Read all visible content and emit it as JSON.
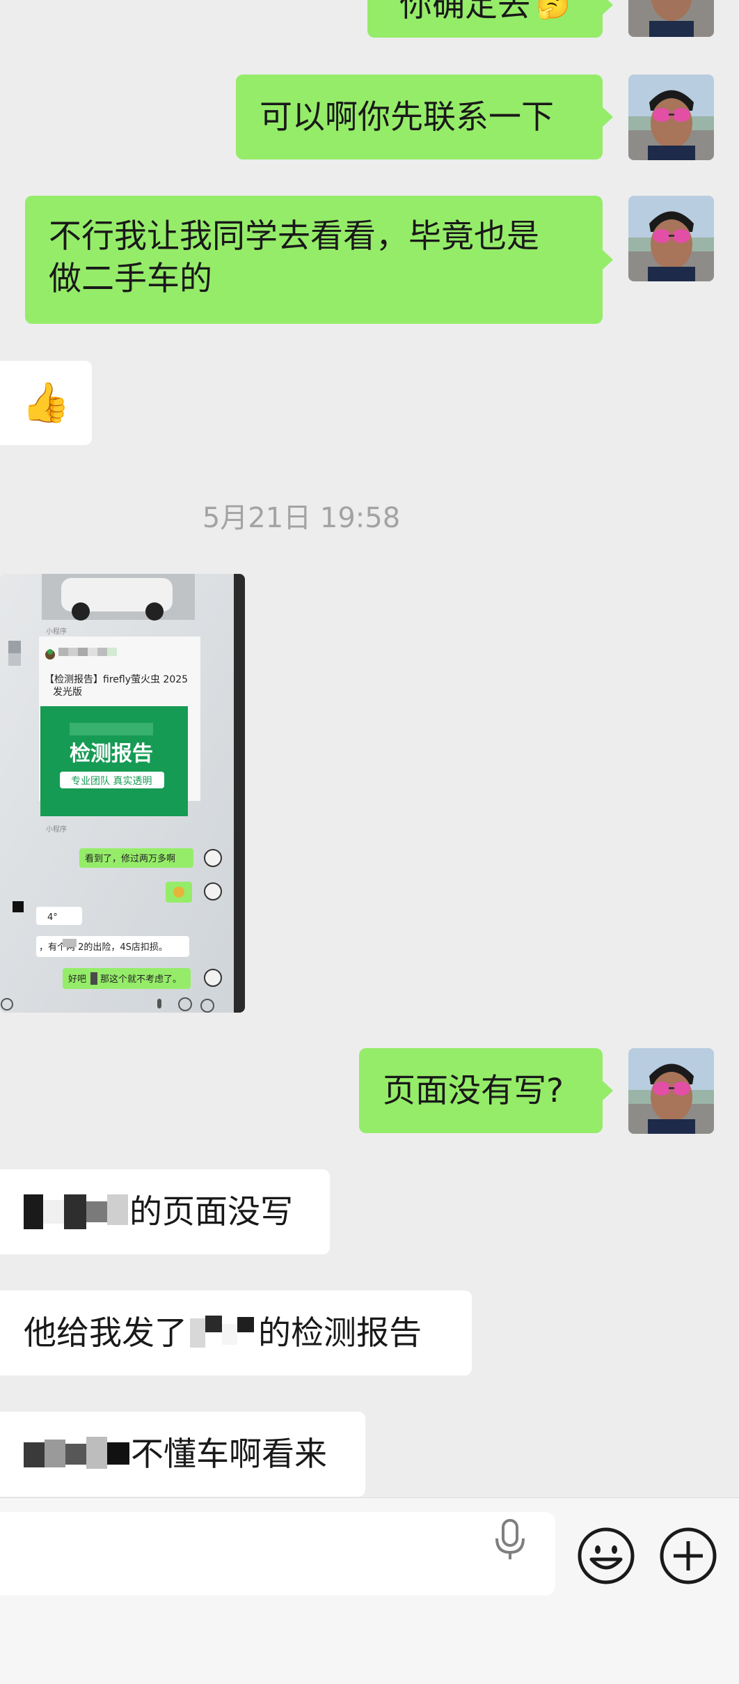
{
  "messages": {
    "m0_partial": "你确定去",
    "m1": "可以啊你先联系一下",
    "m2": "不行我让我同学去看看，毕竟也是做二手车的",
    "m2_line1": "不行我让我同学去看看，毕竟也是",
    "m2_line2": "做二手车的",
    "m3_emoji": "👍",
    "timestamp": "5月21日 19:58",
    "m5": "页面没有写?",
    "m6_text": "的页面没写",
    "m7_prefix": "他给我发了",
    "m7_suffix": "的检测报告",
    "m8_text": "不懂车啊看来"
  },
  "screenshot_image": {
    "mini_program_tag_1": "小程序",
    "card_title_line1": "【检测报告】firefly萤火虫 2025",
    "card_title_line2": "发光版",
    "card_banner_title": "检测报告",
    "card_banner_sub": "专业团队 真实透明",
    "mini_program_tag_2": "小程序",
    "green_msg_1": "看到了，修过两万多啊",
    "grey_msg_1": "4°",
    "grey_msg_2": "，有个两    2的出险，4S店扣损。",
    "green_msg_2_a": "好吧",
    "green_msg_2_b": "那这个就不考虑了。"
  },
  "colors": {
    "my_bubble": "#95ec69",
    "their_bubble": "#ffffff",
    "background": "#ededed"
  },
  "icons": {
    "voice": "microphone-icon",
    "emoji": "smiley-icon",
    "more": "plus-circle-icon"
  }
}
